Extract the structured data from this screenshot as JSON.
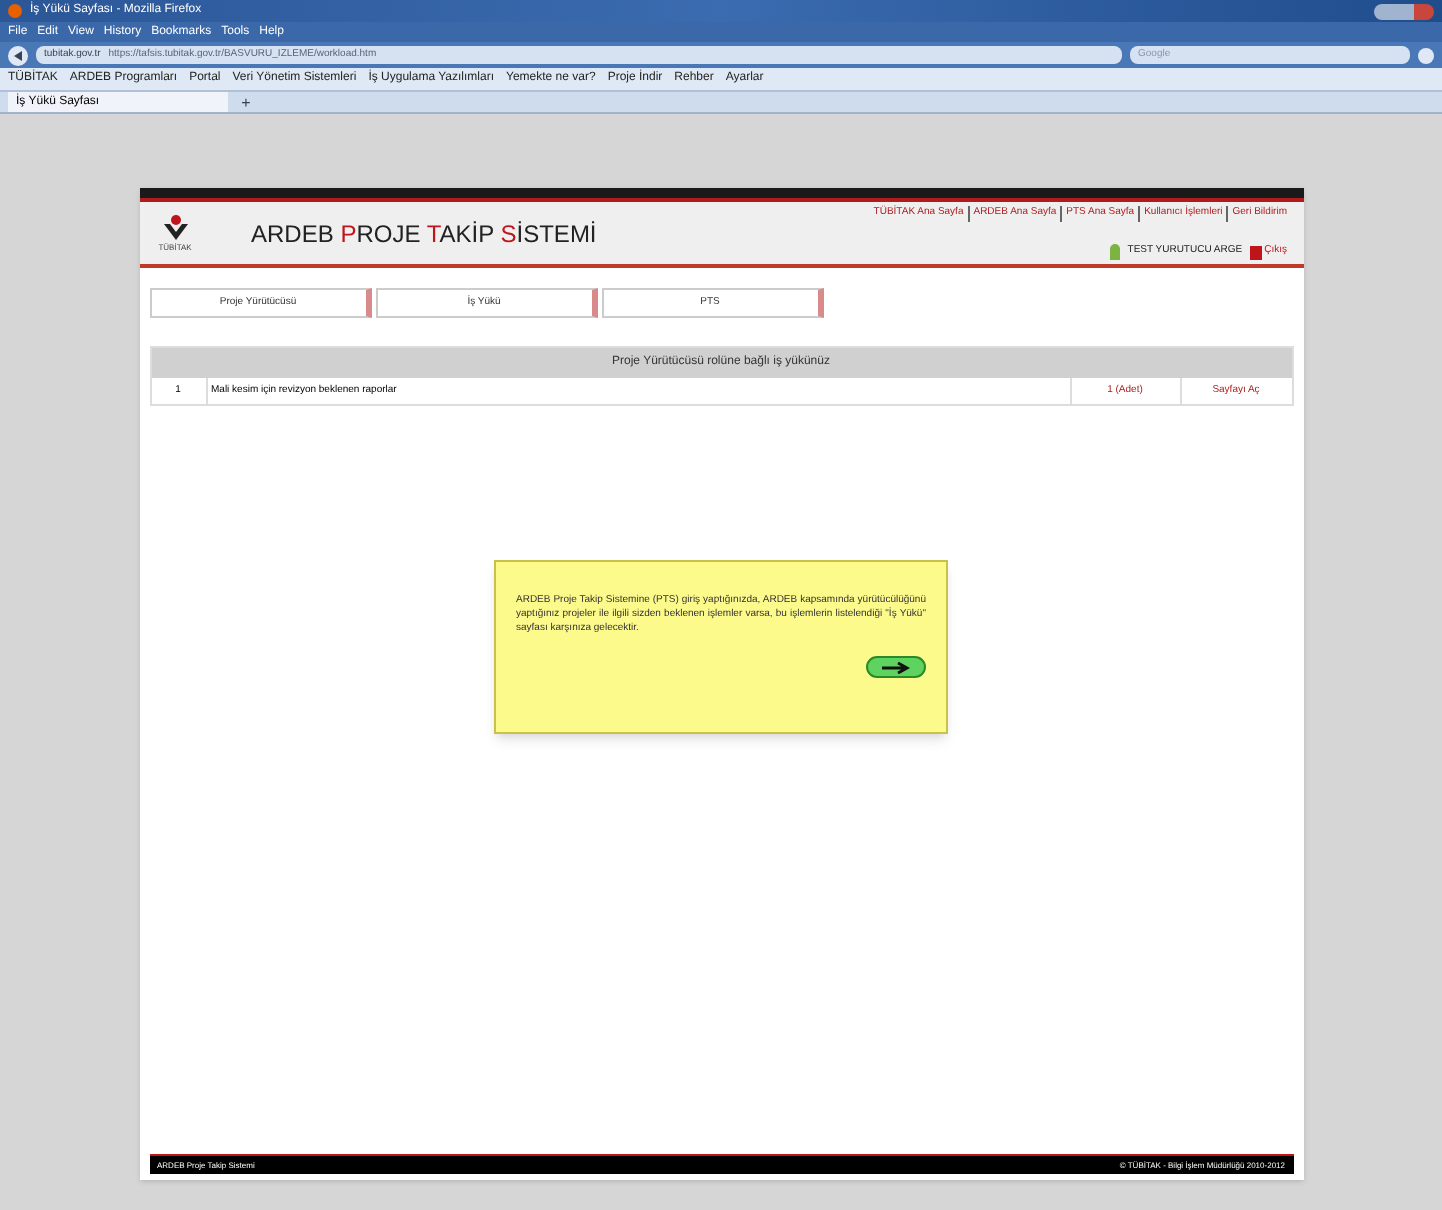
{
  "window": {
    "title": "İş Yükü Sayfası - Mozilla Firefox"
  },
  "menu": [
    "File",
    "Edit",
    "View",
    "History",
    "Bookmarks",
    "Tools",
    "Help"
  ],
  "address_bar": {
    "site": "tubitak.gov.tr",
    "url": "https://tafsis.tubitak.gov.tr/BASVURU_IZLEME/workload.htm"
  },
  "search": {
    "placeholder": "Google"
  },
  "bookmarks": [
    "TÜBİTAK",
    "ARDEB Programları",
    "Portal",
    "Veri Yönetim Sistemleri",
    "İş Uygulama Yazılımları",
    "Yemekte ne var?",
    "Proje İndir",
    "Rehber",
    "Ayarlar"
  ],
  "tab": {
    "label": "İş Yükü Sayfası",
    "add": "+"
  },
  "header": {
    "logo_text": "TÜBİTAK",
    "title": [
      {
        "text": "ARDEB ",
        "accent": false
      },
      {
        "text": "P",
        "accent": true
      },
      {
        "text": "ROJE ",
        "accent": false
      },
      {
        "text": "T",
        "accent": true
      },
      {
        "text": "AKİP ",
        "accent": false
      },
      {
        "text": "S",
        "accent": true
      },
      {
        "text": "İSTEMİ",
        "accent": false
      }
    ],
    "links": [
      "TÜBİTAK Ana Sayfa",
      "ARDEB Ana Sayfa",
      "PTS Ana Sayfa",
      "Kullanıcı İşlemleri",
      "Geri Bildirim"
    ],
    "user": "TEST YURUTUCU ARGE",
    "logout": "Çıkış"
  },
  "nav_tabs": [
    "Proje Yürütücüsü",
    "İş Yükü",
    "PTS"
  ],
  "table": {
    "title": "Proje Yürütücüsü rolüne bağlı iş yükünüz",
    "rows": [
      {
        "no": "1",
        "description": "Mali kesim için revizyon beklenen raporlar",
        "count": "1 (Adet)",
        "action": "Sayfayı Aç"
      }
    ]
  },
  "popup": {
    "text": "ARDEB Proje Takip Sistemine (PTS) giriş yaptığınızda, ARDEB kapsamında yürütücülüğünü yaptığınız projeler ile ilgili sizden beklenen işlemler varsa, bu işlemlerin listelendiği \"İş Yükü\" sayfası karşınıza gelecektir."
  },
  "footer": {
    "left": "ARDEB Proje Takip Sistemi",
    "right": "© TÜBİTAK - Bilgi İşlem Müdürlüğü 2010-2012"
  }
}
